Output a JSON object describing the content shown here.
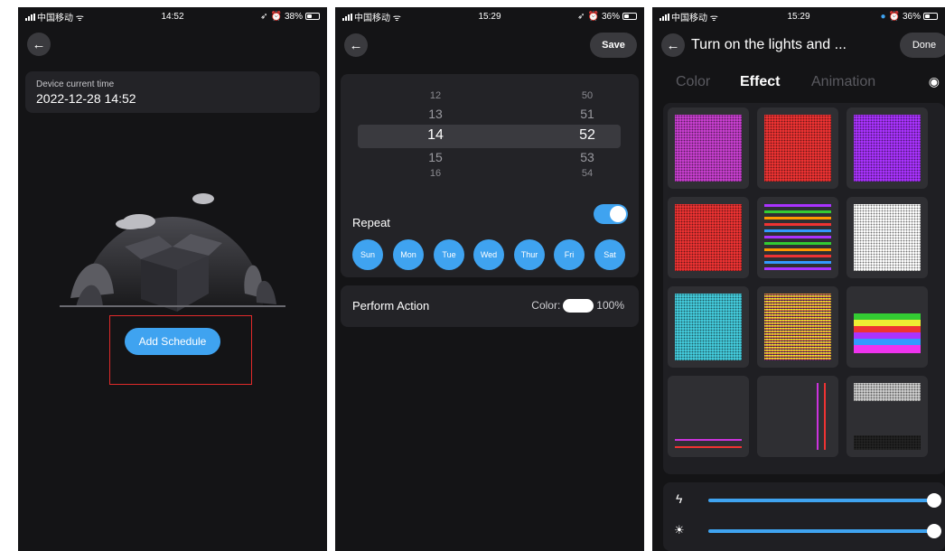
{
  "phone1": {
    "status": {
      "carrier": "中国移动",
      "time": "14:52",
      "battery": "38%"
    },
    "device_time_label": "Device current time",
    "device_time_value": "2022-12-28 14:52",
    "add_button": "Add Schedule"
  },
  "phone2": {
    "status": {
      "carrier": "中国移动",
      "time": "15:29",
      "battery": "36%"
    },
    "save": "Save",
    "picker": {
      "rows": [
        [
          "12",
          "50"
        ],
        [
          "13",
          "51"
        ],
        [
          "14",
          "52"
        ],
        [
          "15",
          "53"
        ],
        [
          "16",
          "54"
        ]
      ],
      "selected_hour": "14",
      "selected_minute": "52"
    },
    "repeat_label": "Repeat",
    "repeat_on": true,
    "days": [
      "Sun",
      "Mon",
      "Tue",
      "Wed",
      "Thur",
      "Fri",
      "Sat"
    ],
    "perform_label": "Perform Action",
    "color_label": "Color:",
    "color_value": "#ffffff",
    "brightness": "100%"
  },
  "phone3": {
    "status": {
      "carrier": "中国移动",
      "time": "15:29",
      "battery": "36%"
    },
    "title": "Turn on the lights and ...",
    "done": "Done",
    "tabs": [
      "Color",
      "Effect",
      "Animation"
    ],
    "active_tab": "Effect",
    "speed_level": 1.0,
    "brightness_level": 1.0
  },
  "colors": {
    "accent": "#3fa3f0",
    "bg": "#141416",
    "card": "#232327",
    "highlight": "#e02a2a"
  }
}
